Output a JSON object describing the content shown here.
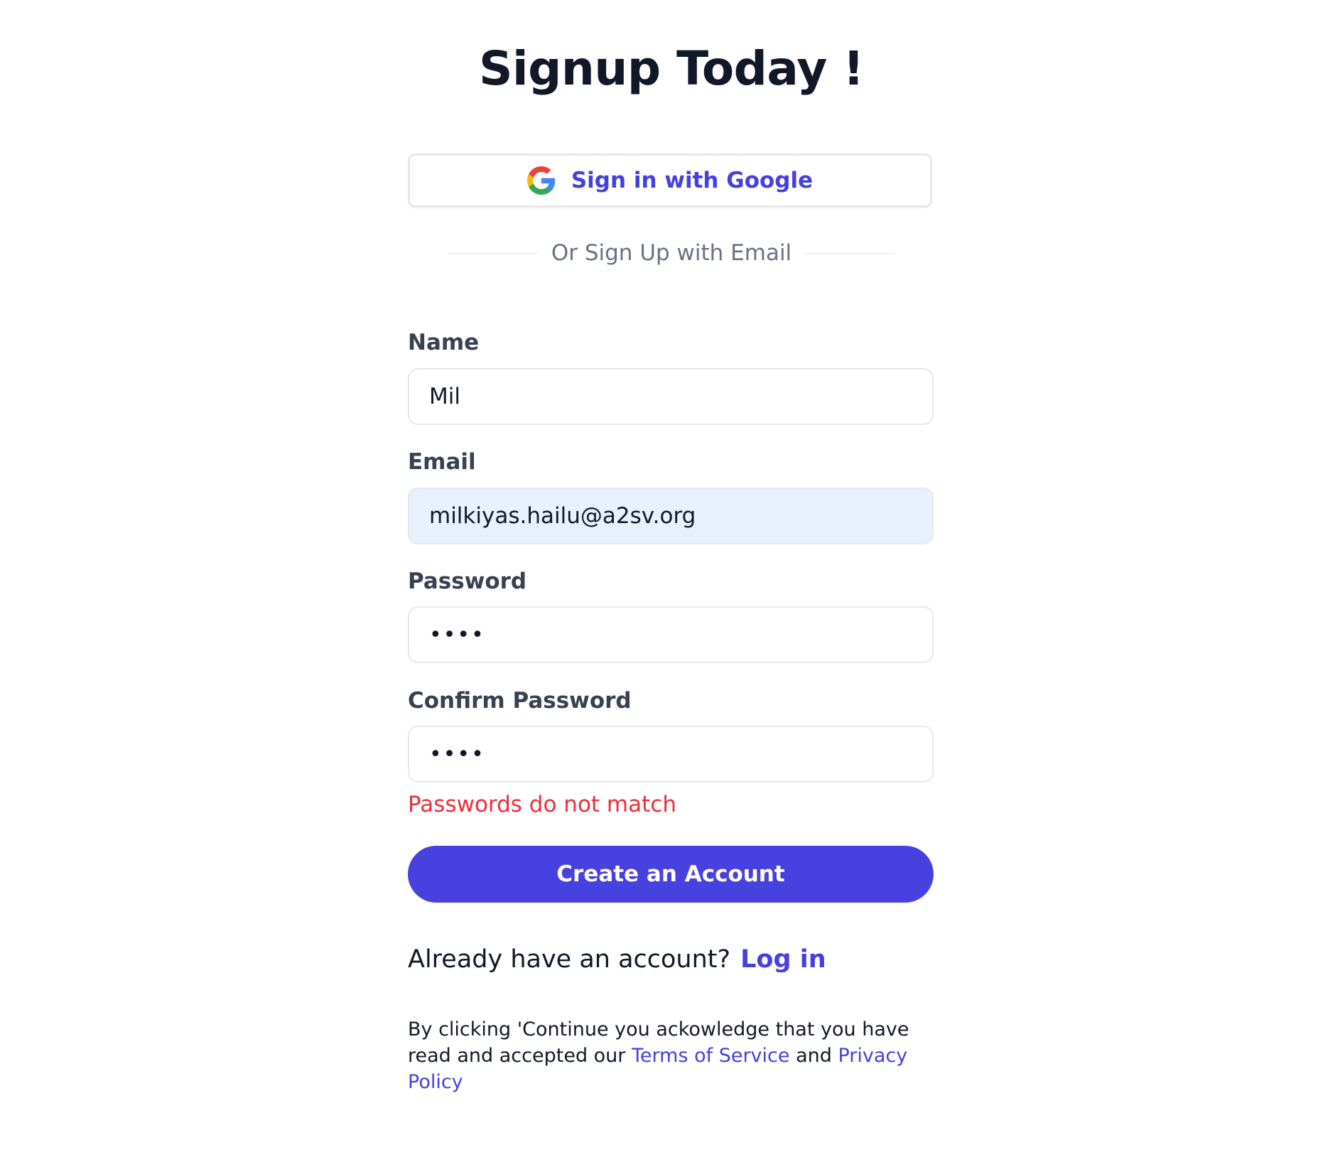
{
  "page": {
    "title": "Signup Today !"
  },
  "google": {
    "label": "Sign in with Google"
  },
  "divider": {
    "text": "Or Sign Up with Email"
  },
  "form": {
    "name_label": "Name",
    "name_value": "Mil",
    "email_label": "Email",
    "email_value": "milkiyas.hailu@a2sv.org",
    "password_label": "Password",
    "password_value": "abcd",
    "confirm_label": "Confirm Password",
    "confirm_value": "abce",
    "error": "Passwords do not match",
    "submit_label": "Create an Account"
  },
  "login": {
    "prompt": "Already have an account?",
    "link": "Log in"
  },
  "terms": {
    "prefix": "By clicking 'Continue you ackowledge that you have read and accepted our",
    "tos": "Terms of Service",
    "and": "and",
    "privacy": "Privacy Policy"
  },
  "colors": {
    "accent": "#4741e0",
    "error": "#ef2d3a",
    "autofill": "#e8f0fe"
  }
}
